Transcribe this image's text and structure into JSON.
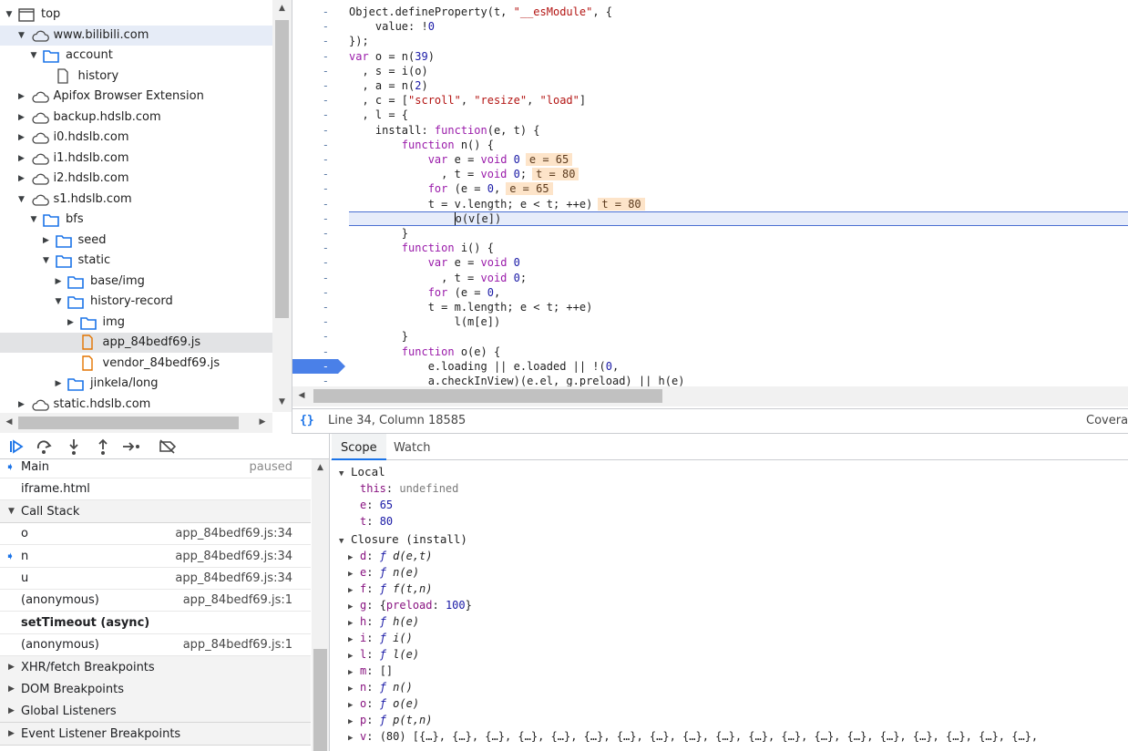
{
  "tree": {
    "items": [
      {
        "label": "top",
        "kind": "frame",
        "expanded": "open"
      },
      {
        "label": "www.bilibili.com",
        "kind": "cloud",
        "expanded": "open"
      },
      {
        "label": "account",
        "kind": "folder",
        "expanded": "open"
      },
      {
        "label": "history",
        "kind": "file-plain",
        "expanded": "none"
      },
      {
        "label": "Apifox Browser Extension",
        "kind": "cloud",
        "expanded": "closed"
      },
      {
        "label": "backup.hdslb.com",
        "kind": "cloud",
        "expanded": "closed"
      },
      {
        "label": "i0.hdslb.com",
        "kind": "cloud",
        "expanded": "closed"
      },
      {
        "label": "i1.hdslb.com",
        "kind": "cloud",
        "expanded": "closed"
      },
      {
        "label": "i2.hdslb.com",
        "kind": "cloud",
        "expanded": "closed"
      },
      {
        "label": "s1.hdslb.com",
        "kind": "cloud",
        "expanded": "open"
      },
      {
        "label": "bfs",
        "kind": "folder",
        "expanded": "open"
      },
      {
        "label": "seed",
        "kind": "folder",
        "expanded": "closed"
      },
      {
        "label": "static",
        "kind": "folder",
        "expanded": "open"
      },
      {
        "label": "base/img",
        "kind": "folder",
        "expanded": "closed"
      },
      {
        "label": "history-record",
        "kind": "folder",
        "expanded": "open"
      },
      {
        "label": "img",
        "kind": "folder",
        "expanded": "closed"
      },
      {
        "label": "app_84bedf69.js",
        "kind": "file-js",
        "expanded": "none"
      },
      {
        "label": "vendor_84bedf69.js",
        "kind": "file-js",
        "expanded": "none"
      },
      {
        "label": "jinkela/long",
        "kind": "folder",
        "expanded": "closed"
      },
      {
        "label": "static.hdslb.com",
        "kind": "cloud",
        "expanded": "closed"
      }
    ]
  },
  "editor": {
    "gutter_mark": "-",
    "lines": [
      {
        "html": "Object.defineProperty(t, <span class=\"str\">\"__esModule\"</span>, {"
      },
      {
        "html": "    value: !<span class=\"num\">0</span>"
      },
      {
        "html": "});"
      },
      {
        "html": "<span class=\"kw\">var</span> o = n(<span class=\"num\">39</span>)"
      },
      {
        "html": "  , s = i(o)"
      },
      {
        "html": "  , a = n(<span class=\"num\">2</span>)"
      },
      {
        "html": "  , c = [<span class=\"str\">\"scroll\"</span>, <span class=\"str\">\"resize\"</span>, <span class=\"str\">\"load\"</span>]"
      },
      {
        "html": "  , l = {"
      },
      {
        "html": "    install: <span class=\"kw\">function</span>(e, t) {"
      },
      {
        "html": "        <span class=\"kw\">function</span> n() {"
      },
      {
        "html": "            <span class=\"kw\">var</span> e = <span class=\"kw\">void</span> <span class=\"num\">0</span><span class=\"inl\">e = 65</span>"
      },
      {
        "html": "              , t = <span class=\"kw\">void</span> <span class=\"num\">0</span>;<span class=\"inl\">t = 80</span>"
      },
      {
        "html": "            <span class=\"kw\">for</span> (e = <span class=\"num\">0</span>,<span class=\"inl\">e = 65</span>"
      },
      {
        "html": "            t = v.length; e &lt; t; ++e)<span class=\"inl\">t = 80</span>"
      },
      {
        "html": "                <span class=\"caret\"></span>o(v[e])"
      },
      {
        "html": "        }"
      },
      {
        "html": "        <span class=\"kw\">function</span> i() {"
      },
      {
        "html": "            <span class=\"kw\">var</span> e = <span class=\"kw\">void</span> <span class=\"num\">0</span>"
      },
      {
        "html": "              , t = <span class=\"kw\">void</span> <span class=\"num\">0</span>;"
      },
      {
        "html": "            <span class=\"kw\">for</span> (e = <span class=\"num\">0</span>,"
      },
      {
        "html": "            t = m.length; e &lt; t; ++e)"
      },
      {
        "html": "                l(m[e])"
      },
      {
        "html": "        }"
      },
      {
        "html": "        <span class=\"kw\">function</span> o(e) {"
      },
      {
        "html": "            e.loading || e.loaded || !(<span class=\"num\">0</span>,"
      },
      {
        "html": "            a.checkInView)(e.el, g.preload) || h(e)"
      }
    ]
  },
  "status": {
    "format_icon": "{}",
    "position": "Line 34, Column 18585",
    "coverage": "Coverage"
  },
  "debugger": {
    "threads": [
      {
        "label": "Main",
        "status": "paused"
      },
      {
        "label": "iframe.html",
        "status": ""
      }
    ],
    "call_stack_title": "Call Stack",
    "call_stack": [
      {
        "fn": "o",
        "loc": "app_84bedf69.js:34"
      },
      {
        "fn": "n",
        "loc": "app_84bedf69.js:34"
      },
      {
        "fn": "u",
        "loc": "app_84bedf69.js:34"
      },
      {
        "fn": "(anonymous)",
        "loc": "app_84bedf69.js:1"
      },
      {
        "fn": "setTimeout (async)",
        "loc": ""
      },
      {
        "fn": "(anonymous)",
        "loc": "app_84bedf69.js:1"
      }
    ],
    "sections": [
      "XHR/fetch Breakpoints",
      "DOM Breakpoints",
      "Global Listeners",
      "Event Listener Breakpoints"
    ]
  },
  "scope": {
    "tabs": [
      "Scope",
      "Watch"
    ],
    "local_title": "Local",
    "local": [
      {
        "key": "this",
        "value": "undefined",
        "type": "gray"
      },
      {
        "key": "e",
        "value": "65",
        "type": "num"
      },
      {
        "key": "t",
        "value": "80",
        "type": "num"
      }
    ],
    "closure_title": "Closure (install)",
    "closure": [
      {
        "key": "d",
        "value": "d(e,t)",
        "type": "fn"
      },
      {
        "key": "e",
        "value": "n(e)",
        "type": "fn"
      },
      {
        "key": "f",
        "value": "f(t,n)",
        "type": "fn"
      },
      {
        "key": "g",
        "value": "{preload: 100}",
        "type": "obj"
      },
      {
        "key": "h",
        "value": "h(e)",
        "type": "fn"
      },
      {
        "key": "i",
        "value": "i()",
        "type": "fn"
      },
      {
        "key": "l",
        "value": "l(e)",
        "type": "fn"
      },
      {
        "key": "m",
        "value": "[]",
        "type": "arr"
      },
      {
        "key": "n",
        "value": "n()",
        "type": "fn"
      },
      {
        "key": "o",
        "value": "o(e)",
        "type": "fn"
      },
      {
        "key": "p",
        "value": "p(t,n)",
        "type": "fn"
      },
      {
        "key": "v",
        "value": "(80) [{…}, {…}, {…}, {…}, {…}, {…}, {…}, {…}, {…}, {…}, {…}, {…}, {…}, {…}, {…}, {…}, {…}, {…}, {…},",
        "type": "arr"
      }
    ]
  }
}
